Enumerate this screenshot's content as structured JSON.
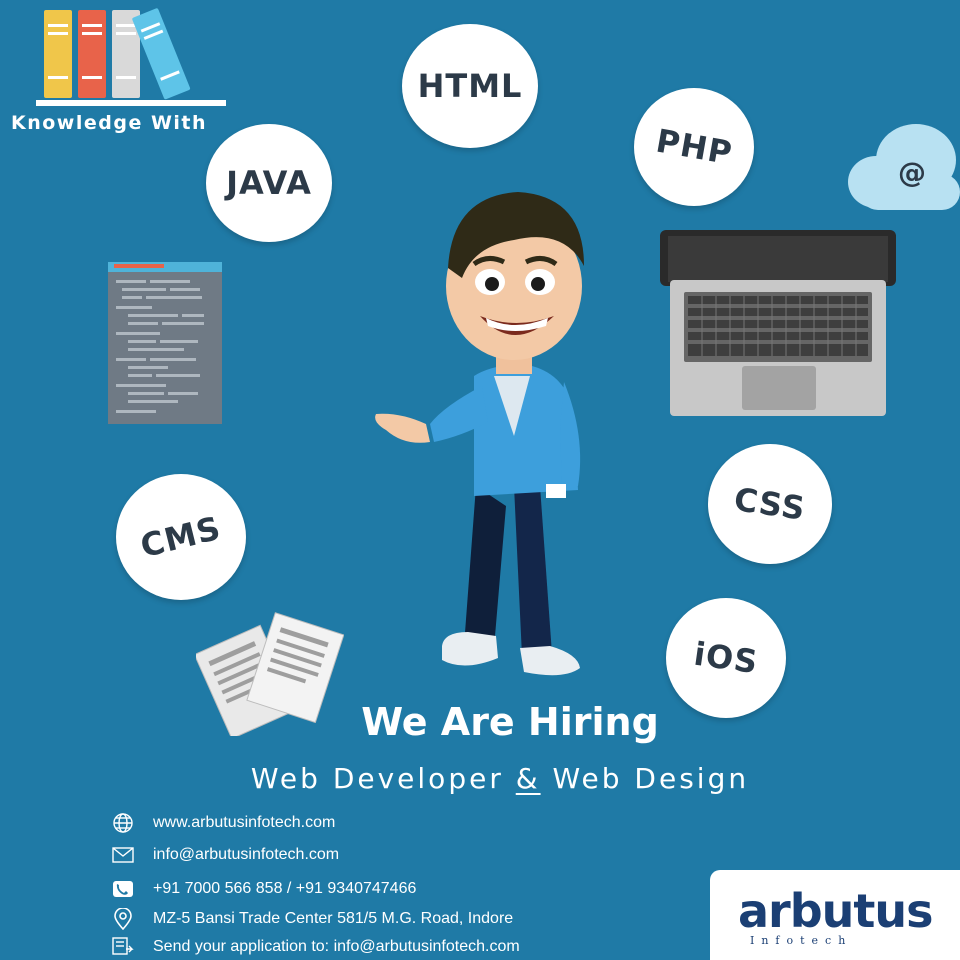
{
  "brand": {
    "tagline": "Knowledge With",
    "logo_text": "arbutus",
    "logo_sub": "Infotech",
    "colors": {
      "background": "#1f7aa6",
      "book_yellow": "#f0c64a",
      "book_red": "#e8634a",
      "book_grey": "#d9d9d9",
      "book_blue": "#5ec4e8"
    }
  },
  "bubbles": {
    "html": "HTML",
    "java": "JAVA",
    "php": "PHP",
    "cms": "CMS",
    "css": "CSS",
    "ios": "iOS"
  },
  "cloud": {
    "symbol": "@"
  },
  "headline": {
    "title": "We Are Hiring",
    "subtitle_part1": "Web Developer",
    "subtitle_amp": "&",
    "subtitle_part2": "Web Design"
  },
  "contact": {
    "website": "www.arbutusinfotech.com",
    "email": "info@arbutusinfotech.com",
    "phone": "+91 7000 566 858 / +91 9340747466",
    "address": "MZ-5 Bansi Trade Center  581/5 M.G. Road, Indore",
    "apply": "Send your application to: info@arbutusinfotech.com"
  },
  "icons": [
    "books-icon",
    "cloud-at-icon",
    "code-document-icon",
    "laptop-icon",
    "papers-icon",
    "globe-icon",
    "mail-icon",
    "phone-icon",
    "location-pin-icon",
    "send-icon"
  ]
}
